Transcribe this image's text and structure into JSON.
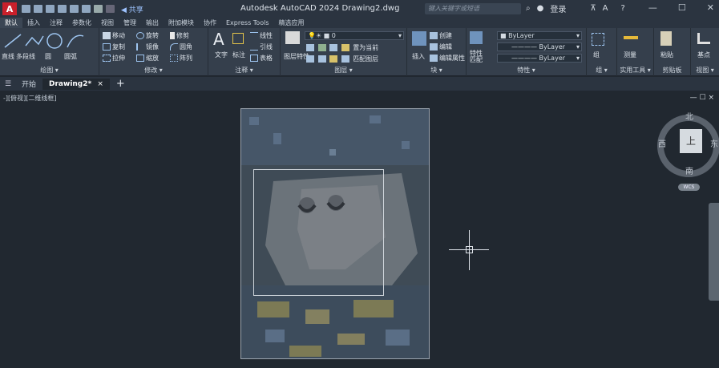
{
  "titlebar": {
    "logo": "A",
    "share": "共享",
    "title": "Autodesk AutoCAD 2024   Drawing2.dwg",
    "search_placeholder": "键入关键字或短语",
    "signin": "登录",
    "minimize": "—",
    "maximize": "☐",
    "close": "✕"
  },
  "ribbon_tabs": [
    "默认",
    "插入",
    "注释",
    "参数化",
    "视图",
    "管理",
    "输出",
    "附加模块",
    "协作",
    "Express Tools",
    "精选应用"
  ],
  "ribbon": {
    "draw": {
      "line": "直线",
      "polyline": "多段线",
      "circle": "圆",
      "arc": "圆弧",
      "title": "绘图"
    },
    "modify": {
      "move": "移动",
      "rotate": "旋转",
      "trim": "修剪",
      "copy": "复制",
      "mirror": "镜像",
      "fillet": "圆角",
      "stretch": "拉伸",
      "scale": "缩放",
      "array": "阵列",
      "title": "修改"
    },
    "annotation": {
      "text": "文字",
      "dimension": "标注",
      "linear": "线性",
      "leader": "引线",
      "table": "表格",
      "title": "注释"
    },
    "layers": {
      "layer_props": "图层特性",
      "current_layer": "0",
      "make_current": "置为当前",
      "match_layer": "匹配图层",
      "title": "图层"
    },
    "block": {
      "insert": "插入",
      "create": "创建",
      "edit": "编辑",
      "edit_attr": "编辑属性",
      "title": "块"
    },
    "properties": {
      "match": "特性匹配",
      "color": "ByLayer",
      "linetype": "ByLayer",
      "lineweight": "ByLayer",
      "title": "特性"
    },
    "groups": {
      "title": "组",
      "group": "组"
    },
    "utilities": {
      "measure": "测量",
      "title": "实用工具"
    },
    "clipboard": {
      "paste": "粘贴",
      "title": "剪贴板"
    },
    "view": {
      "base": "基点",
      "title": "视图"
    }
  },
  "doc_tabs": {
    "start": "开始",
    "drawing": "Drawing2*",
    "close": "×",
    "add": "+"
  },
  "viewport": {
    "label": "-][俯视][二维线框]",
    "controls": "— ☐ ×",
    "viewcube": {
      "north": "北",
      "south": "南",
      "east": "东",
      "west": "西",
      "face": "上",
      "wcs": "WCS"
    }
  }
}
